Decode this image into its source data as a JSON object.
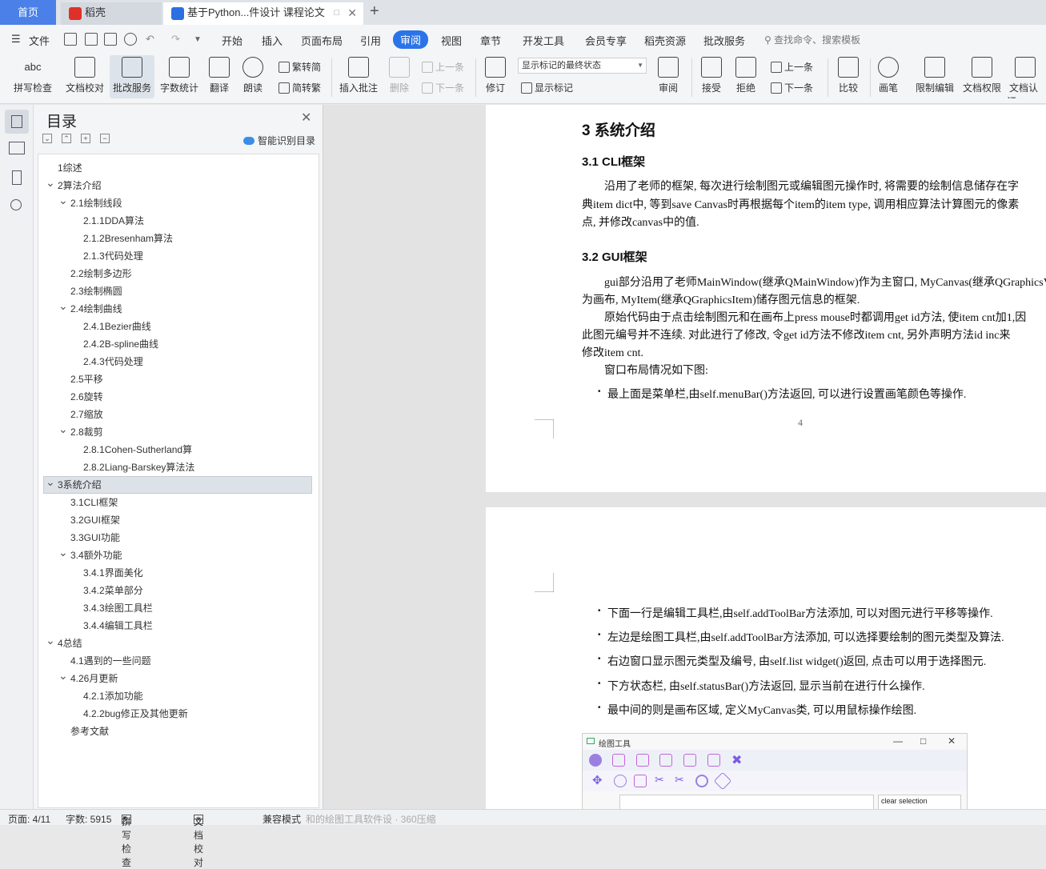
{
  "tabs": {
    "home": "首页",
    "daoke": "稻壳",
    "doc": "基于Python...件设计 课程论文"
  },
  "menu": {
    "file": "文件",
    "items": [
      "开始",
      "插入",
      "页面布局",
      "引用",
      "审阅",
      "视图",
      "章节",
      "开发工具",
      "会员专享",
      "稻壳资源",
      "批改服务"
    ],
    "active": "审阅",
    "search": "查找命令、搜索模板"
  },
  "ribbon": {
    "spell": "拼写检查",
    "proof": "文档校对",
    "correct": "批改服务",
    "wordcount": "字数统计",
    "translate": "翻译",
    "read": "朗读",
    "trad": "繁转简",
    "simp": "简转繁",
    "insert_comment": "插入批注",
    "delete": "删除",
    "prev_comment": "上一条",
    "next_comment": "下一条",
    "revise": "修订",
    "state_select": "显示标记的最终状态",
    "show_marks": "显示标记",
    "review": "审阅",
    "accept": "接受",
    "reject": "拒绝",
    "prev_change": "上一条",
    "next_change": "下一条",
    "compare": "比较",
    "pen": "画笔",
    "restrict": "限制编辑",
    "rights": "文档权限",
    "cert": "文档认证"
  },
  "toc": {
    "title": "目录",
    "smart": "智能识别目录",
    "items": [
      {
        "label": "1综述",
        "level": 1,
        "chev": ""
      },
      {
        "label": "2算法介绍",
        "level": 1,
        "chev": "v"
      },
      {
        "label": "2.1绘制线段",
        "level": 2,
        "chev": "v"
      },
      {
        "label": "2.1.1DDA算法",
        "level": 3,
        "chev": ""
      },
      {
        "label": "2.1.2Bresenham算法",
        "level": 3,
        "chev": ""
      },
      {
        "label": "2.1.3代码处理",
        "level": 3,
        "chev": ""
      },
      {
        "label": "2.2绘制多边形",
        "level": 2,
        "chev": ""
      },
      {
        "label": "2.3绘制椭圆",
        "level": 2,
        "chev": ""
      },
      {
        "label": "2.4绘制曲线",
        "level": 2,
        "chev": "v"
      },
      {
        "label": "2.4.1Bezier曲线",
        "level": 3,
        "chev": ""
      },
      {
        "label": "2.4.2B-spline曲线",
        "level": 3,
        "chev": ""
      },
      {
        "label": "2.4.3代码处理",
        "level": 3,
        "chev": ""
      },
      {
        "label": "2.5平移",
        "level": 2,
        "chev": ""
      },
      {
        "label": "2.6旋转",
        "level": 2,
        "chev": ""
      },
      {
        "label": "2.7缩放",
        "level": 2,
        "chev": ""
      },
      {
        "label": "2.8裁剪",
        "level": 2,
        "chev": "v"
      },
      {
        "label": "2.8.1Cohen-Sutherland算",
        "level": 3,
        "chev": ""
      },
      {
        "label": "2.8.2Liang-Barskey算法法",
        "level": 3,
        "chev": ""
      },
      {
        "label": "3系统介绍",
        "level": 1,
        "chev": "v",
        "active": true
      },
      {
        "label": "3.1CLI框架",
        "level": 2,
        "chev": ""
      },
      {
        "label": "3.2GUI框架",
        "level": 2,
        "chev": ""
      },
      {
        "label": "3.3GUI功能",
        "level": 2,
        "chev": ""
      },
      {
        "label": "3.4额外功能",
        "level": 2,
        "chev": "v"
      },
      {
        "label": "3.4.1界面美化",
        "level": 3,
        "chev": ""
      },
      {
        "label": "3.4.2菜单部分",
        "level": 3,
        "chev": ""
      },
      {
        "label": "3.4.3绘图工具栏",
        "level": 3,
        "chev": ""
      },
      {
        "label": "3.4.4编辑工具栏",
        "level": 3,
        "chev": ""
      },
      {
        "label": "4总结",
        "level": 1,
        "chev": "v"
      },
      {
        "label": "4.1遇到的一些问题",
        "level": 2,
        "chev": ""
      },
      {
        "label": "4.26月更新",
        "level": 2,
        "chev": "v"
      },
      {
        "label": "4.2.1添加功能",
        "level": 3,
        "chev": ""
      },
      {
        "label": "4.2.2bug修正及其他更新",
        "level": 3,
        "chev": ""
      },
      {
        "label": "参考文献",
        "level": 2,
        "chev": ""
      }
    ]
  },
  "doc": {
    "h_sys": "3    系统介绍",
    "h_cli": "3.1    CLI框架",
    "cli_l1": "沿用了老师的框架, 每次进行绘制图元或编辑图元操作时, 将需要的绘制信息储存在字",
    "cli_l2": "典item dict中, 等到save Canvas时再根据每个item的item type, 调用相应算法计算图元的像素",
    "cli_l3": "点, 并修改canvas中的值.",
    "h_gui": "3.2    GUI框架",
    "gui_l1": "gui部分沿用了老师MainWindow(继承QMainWindow)作为主窗口, MyCanvas(继承QGraphicsV",
    "gui_l2": "为画布, MyItem(继承QGraphicsItem)储存图元信息的框架.",
    "gui_l3": "原始代码由于点击绘制图元和在画布上press mouse时都调用get id方法, 使item cnt加1,因",
    "gui_l4": "此图元编号并不连续. 对此进行了修改, 令get id方法不修改item cnt, 另外声明方法id inc来",
    "gui_l5": "修改item cnt.",
    "gui_l6": "窗口布局情况如下图:",
    "b1": "最上面是菜单栏,由self.menuBar()方法返回, 可以进行设置画笔颜色等操作.",
    "page_no": "4",
    "b2": "下面一行是编辑工具栏,由self.addToolBar方法添加, 可以对图元进行平移等操作.",
    "b3": "左边是绘图工具栏,由self.addToolBar方法添加, 可以选择要绘制的图元类型及算法.",
    "b4": "右边窗口显示图元类型及编号, 由self.list widget()返回, 点击可以用于选择图元.",
    "b5": "下方状态栏, 由self.statusBar()方法返回, 显示当前在进行什么操作.",
    "b6": "最中间的则是画布区域, 定义MyCanvas类, 可以用鼠标操作绘图.",
    "app_title": "绘图工具",
    "app_clear": "clear selection"
  },
  "status": {
    "page": "页面: 4/11",
    "words": "字数: 5915",
    "spell": "拼写检查",
    "proof": "文档校对",
    "compat": "兼容模式",
    "faded": "和的绘图工具软件设 · 360压缩"
  }
}
